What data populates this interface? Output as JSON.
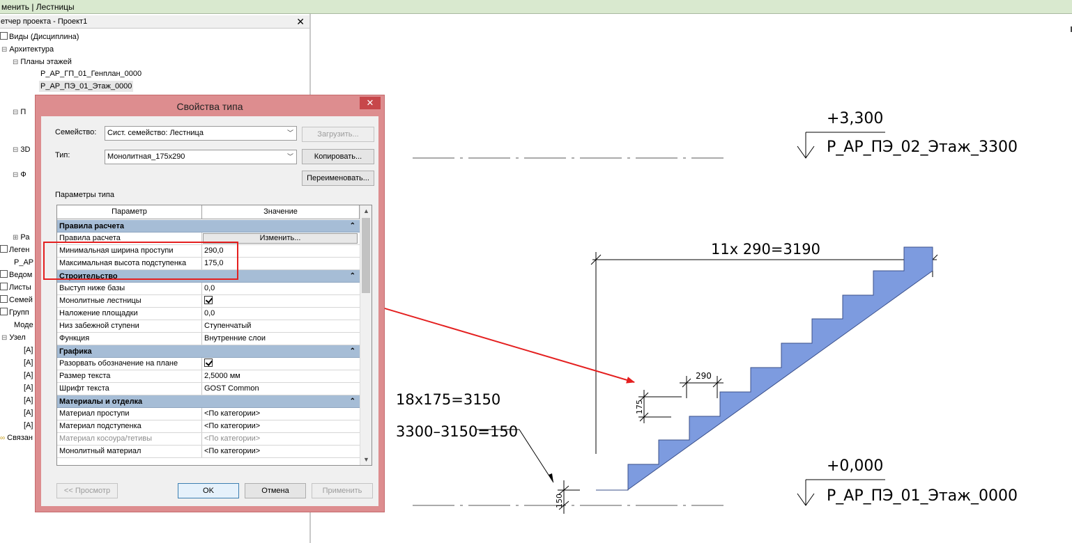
{
  "topbar": {
    "text": "менить | Лестницы"
  },
  "browser": {
    "title": "етчер проекта - Проект1",
    "items": [
      "Виды (Дисциплина)",
      "Архитектура",
      "Планы этажей",
      "Р_АР_ГП_01_Генплан_0000",
      "Р_АР_ПЭ_01_Этаж_0000",
      "П",
      "3D",
      "Ф",
      "Ра",
      "Леген",
      "Р_АР",
      "Ведом",
      "Листы",
      "Семей",
      "Групп",
      "Моде",
      "Узел",
      "[А]",
      "[А]",
      "[А]",
      "[А]",
      "[А]",
      "[А]",
      "[А]",
      "Связан"
    ]
  },
  "dialog": {
    "title": "Свойства типа",
    "close": "✕",
    "family_label": "Семейство:",
    "family_value": "Сист. семейство: Лестница",
    "type_label": "Тип:",
    "type_value": "Монолитная_175х290",
    "load_btn": "Загрузить...",
    "copy_btn": "Копировать...",
    "rename_btn": "Переименовать...",
    "params_label": "Параметры типа",
    "col_param": "Параметр",
    "col_value": "Значение",
    "groups": [
      {
        "name": "Правила расчета",
        "rows": [
          {
            "p": "Правила расчета",
            "v": "Изменить...",
            "kind": "button"
          },
          {
            "p": "Минимальная ширина проступи",
            "v": "290,0"
          },
          {
            "p": "Максимальная высота подступенка",
            "v": "175,0"
          }
        ]
      },
      {
        "name": "Строительство",
        "rows": [
          {
            "p": "Выступ ниже базы",
            "v": "0,0"
          },
          {
            "p": "Монолитные лестницы",
            "v": "",
            "kind": "check"
          },
          {
            "p": "Наложение площадки",
            "v": "0,0"
          },
          {
            "p": "Низ забежной ступени",
            "v": "Ступенчатый"
          },
          {
            "p": "Функция",
            "v": "Внутренние слои"
          }
        ]
      },
      {
        "name": "Графика",
        "rows": [
          {
            "p": "Разорвать обозначение на плане",
            "v": "",
            "kind": "check"
          },
          {
            "p": "Размер текста",
            "v": "2,5000 мм"
          },
          {
            "p": "Шрифт текста",
            "v": "GOST Common"
          }
        ]
      },
      {
        "name": "Материалы и отделка",
        "rows": [
          {
            "p": "Материал проступи",
            "v": "<По категории>"
          },
          {
            "p": "Материал подступенка",
            "v": "<По категории>"
          },
          {
            "p": "Материал косоура/тетивы",
            "v": "<По категории>",
            "kind": "dim"
          },
          {
            "p": "Монолитный материал",
            "v": "<По категории>"
          }
        ]
      }
    ],
    "preview_btn": "<< Просмотр",
    "ok_btn": "OK",
    "cancel_btn": "Отмена",
    "apply_btn": "Применить"
  },
  "drawing": {
    "level_top_elev": "+3,300",
    "level_top_name": "Р_АР_ПЭ_02_Этаж_3300",
    "level_bottom_elev": "+0,000",
    "level_bottom_name": "Р_АР_ПЭ_01_Этаж_0000",
    "dim_total": "11х 290=3190",
    "dim_tread": "290",
    "dim_riser": "175",
    "dim_bottom": "150",
    "note_risers": "18х175=3150",
    "note_diff": "3300–3150=150",
    "stair_color": "#7d9bdf",
    "highlight_color": "#e41f1f"
  }
}
